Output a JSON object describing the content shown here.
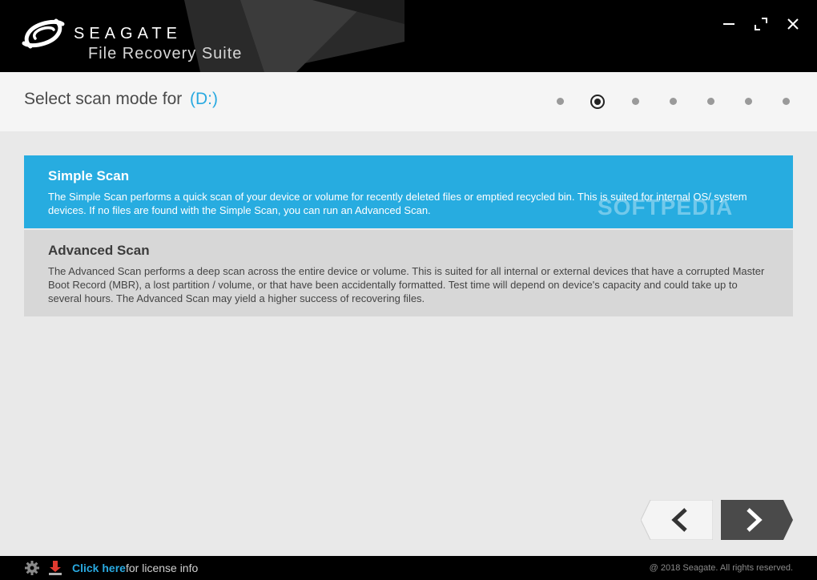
{
  "titlebar": {
    "brand": "SEAGATE",
    "product": "File Recovery Suite",
    "logo_icon": "seagate-logo-icon",
    "controls": [
      "minimize-icon",
      "maximize-icon",
      "close-icon"
    ]
  },
  "header": {
    "title": "Select scan mode for",
    "drive": "(D:)",
    "steps_total": 7,
    "current_step": 2
  },
  "options": {
    "simple": {
      "title": "Simple Scan",
      "description": "The Simple Scan performs a quick scan of your device or volume for recently deleted files or emptied recycled bin.  This is suited for internal OS/ system devices.  If no files are found with the Simple Scan, you can run an Advanced Scan.",
      "selected": true
    },
    "advanced": {
      "title": "Advanced Scan",
      "description": "The Advanced Scan performs a deep scan across the entire device or volume.  This is suited for all internal or external devices that have a corrupted Master Boot Record (MBR), a lost partition / volume, or that have been accidentally formatted.  Test time will depend on device's capacity and could take up to several hours.  The Advanced Scan may yield a higher success of recovering files.",
      "selected": false
    }
  },
  "watermark": "SOFTPEDIA",
  "navigation": {
    "back_icon": "chevron-left-icon",
    "next_icon": "chevron-right-icon"
  },
  "footer": {
    "link_text": "Click here",
    "link_suffix": "for license info",
    "copyright": "@ 2018 Seagate. All rights reserved."
  },
  "colors": {
    "accent": "#27ace0",
    "titlebar": "#000000",
    "header": "#f5f5f5",
    "unselected_option": "#d7d7d7",
    "next_button": "#4a4a4a"
  }
}
